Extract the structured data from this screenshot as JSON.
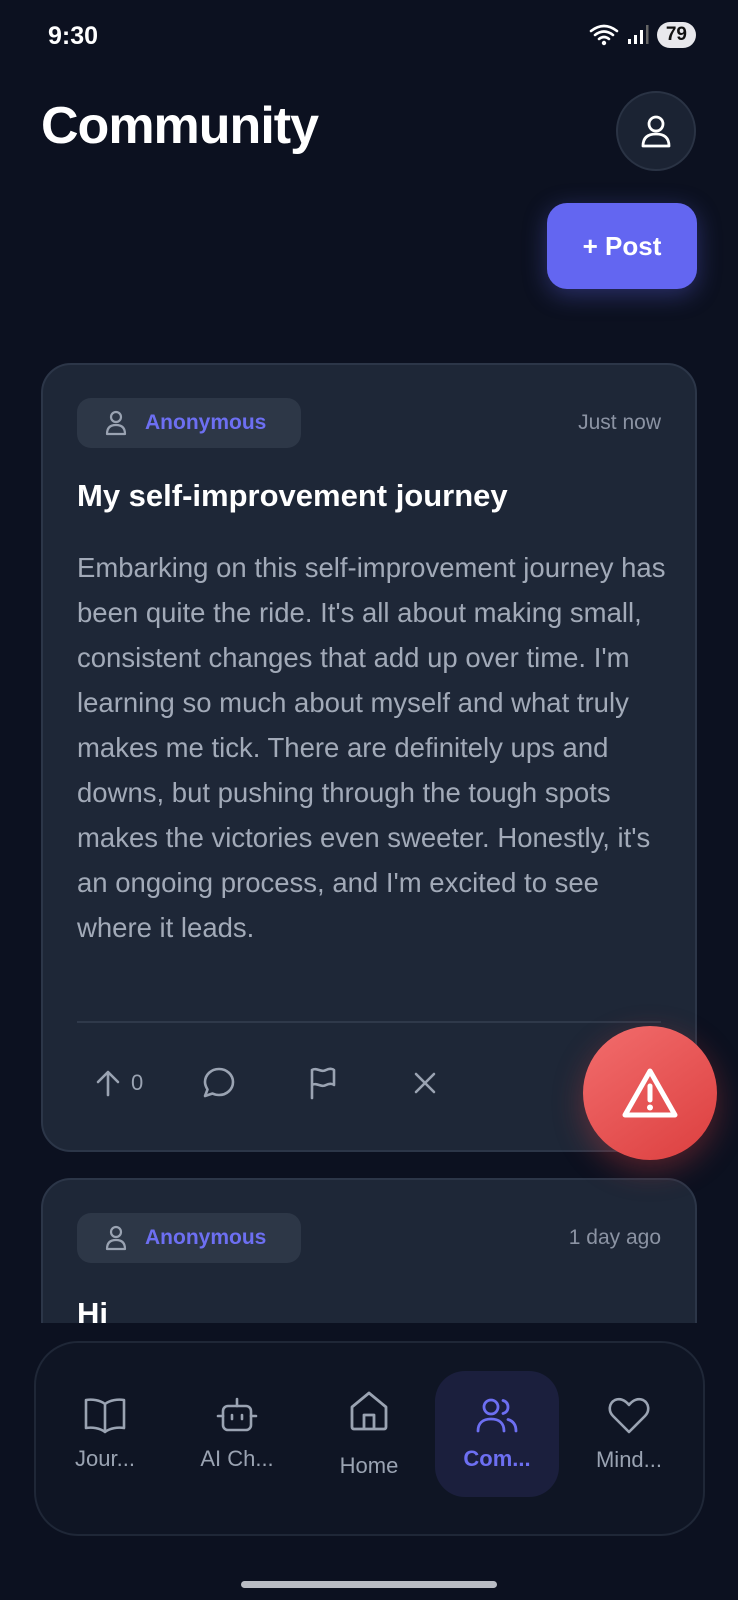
{
  "status_bar": {
    "time": "9:30",
    "battery": "79"
  },
  "header": {
    "title": "Community",
    "post_button": "+ Post"
  },
  "posts": [
    {
      "author": "Anonymous",
      "time": "Just now",
      "title": "My self-improvement journey",
      "body": "Embarking on this self-improvement journey has been quite the ride. It's all about making small, consistent changes that add up over time. I'm learning so much about myself and what truly makes me tick. There are definitely ups and downs, but pushing through the tough spots makes the victories even sweeter. Honestly, it's an ongoing process, and I'm excited to see where it leads.",
      "upvotes": "0"
    },
    {
      "author": "Anonymous",
      "time": "1 day ago",
      "title": "Hi"
    }
  ],
  "nav": {
    "items": [
      {
        "label": "Jour...",
        "icon": "book-icon"
      },
      {
        "label": "AI Ch...",
        "icon": "robot-icon"
      },
      {
        "label": "Home",
        "icon": "home-icon"
      },
      {
        "label": "Com...",
        "icon": "users-icon",
        "active": true
      },
      {
        "label": "Mind...",
        "icon": "heart-icon"
      }
    ]
  },
  "colors": {
    "accent": "#6366f1",
    "background": "#0c1120",
    "card": "#1e2737",
    "danger": "#e5534b"
  }
}
